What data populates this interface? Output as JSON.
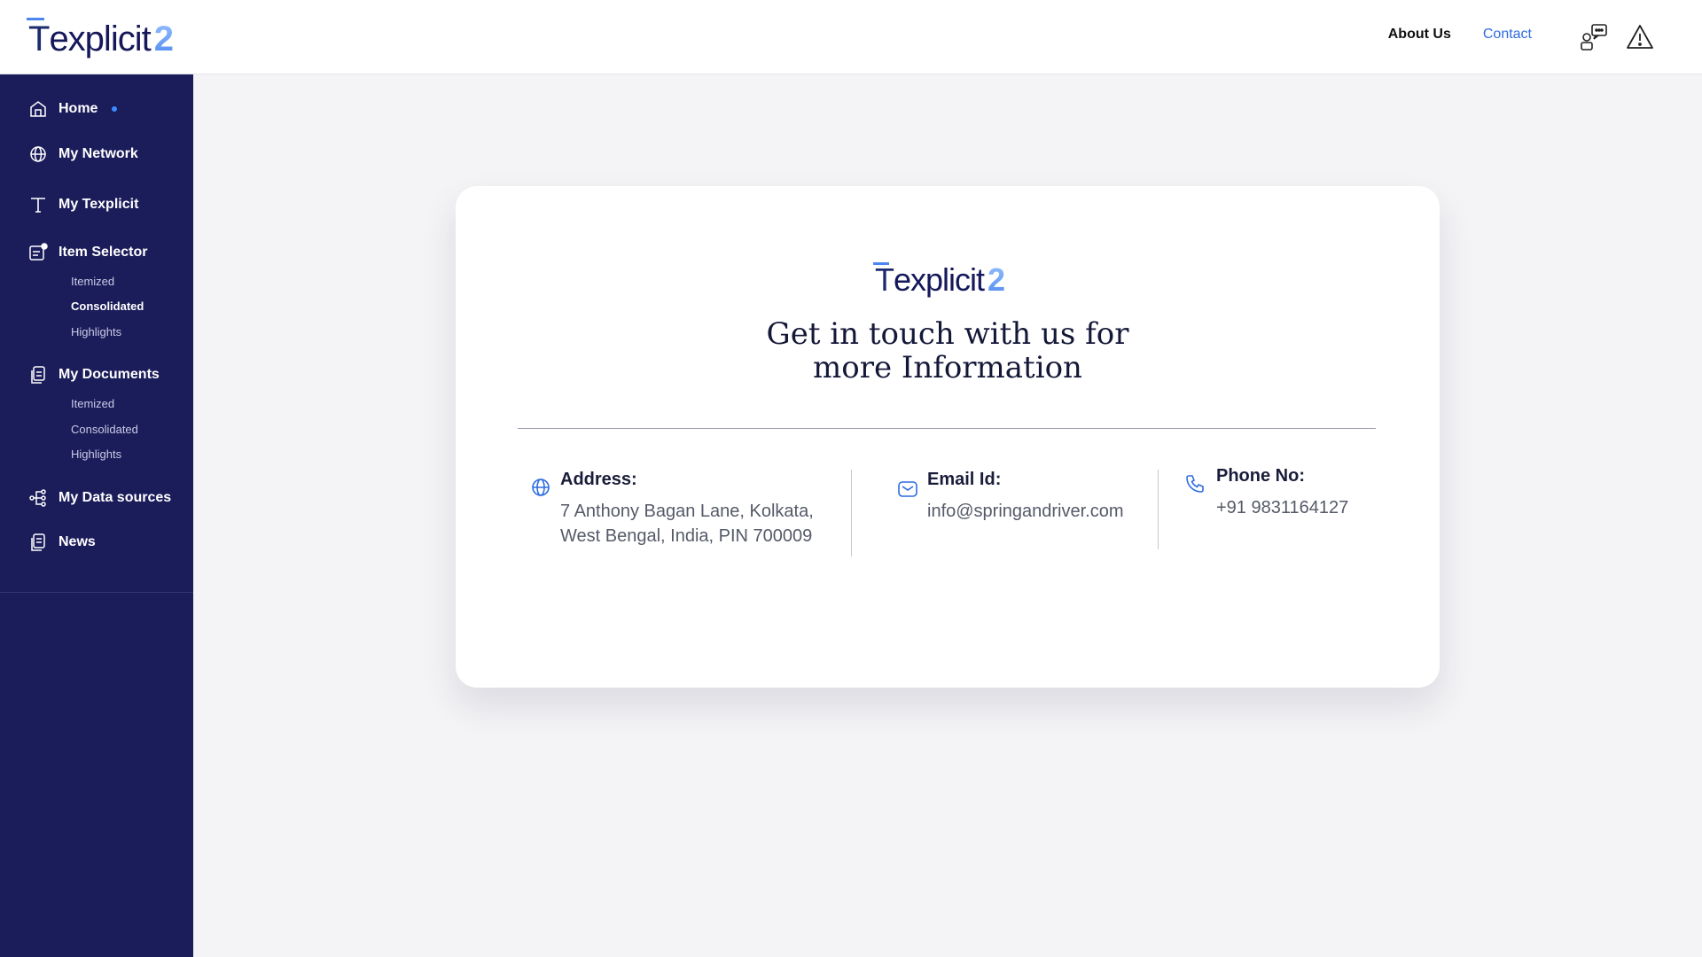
{
  "header": {
    "logo": {
      "letter": "T",
      "word": "explicit",
      "version": "2"
    },
    "nav": {
      "about": "About Us",
      "contact": "Contact"
    },
    "icons": [
      "support-chat-icon",
      "alert-icon"
    ],
    "accent_color": "#2f6ce0"
  },
  "sidebar": {
    "background": "#1b1c5a",
    "items": [
      {
        "label": "Home",
        "icon": "home-icon",
        "active": true
      },
      {
        "label": "My Network",
        "icon": "globe-icon"
      },
      {
        "label": "My Texplicit",
        "icon": "text-t-icon"
      },
      {
        "label": "Item Selector",
        "icon": "selector-icon",
        "sub": [
          {
            "label": "Itemized"
          },
          {
            "label": "Consolidated",
            "active": true
          },
          {
            "label": "Highlights"
          }
        ]
      },
      {
        "label": "My Documents",
        "icon": "documents-icon",
        "sub": [
          {
            "label": "Itemized"
          },
          {
            "label": "Consolidated"
          },
          {
            "label": "Highlights"
          }
        ]
      },
      {
        "label": "My Data sources",
        "icon": "data-sources-icon"
      },
      {
        "label": "News",
        "icon": "news-icon"
      }
    ]
  },
  "card": {
    "logo": {
      "letter": "T",
      "word": "explicit",
      "version": "2"
    },
    "heading_line1": "Get in touch with us for",
    "heading_line2": "more Information",
    "address": {
      "title": "Address:",
      "line1": "7 Anthony Bagan Lane, Kolkata,",
      "line2": "West Bengal, India, PIN 700009"
    },
    "email": {
      "title": "Email Id:",
      "value": "info@springandriver.com"
    },
    "phone": {
      "title": "Phone No:",
      "value": "+91 9831164127"
    }
  }
}
